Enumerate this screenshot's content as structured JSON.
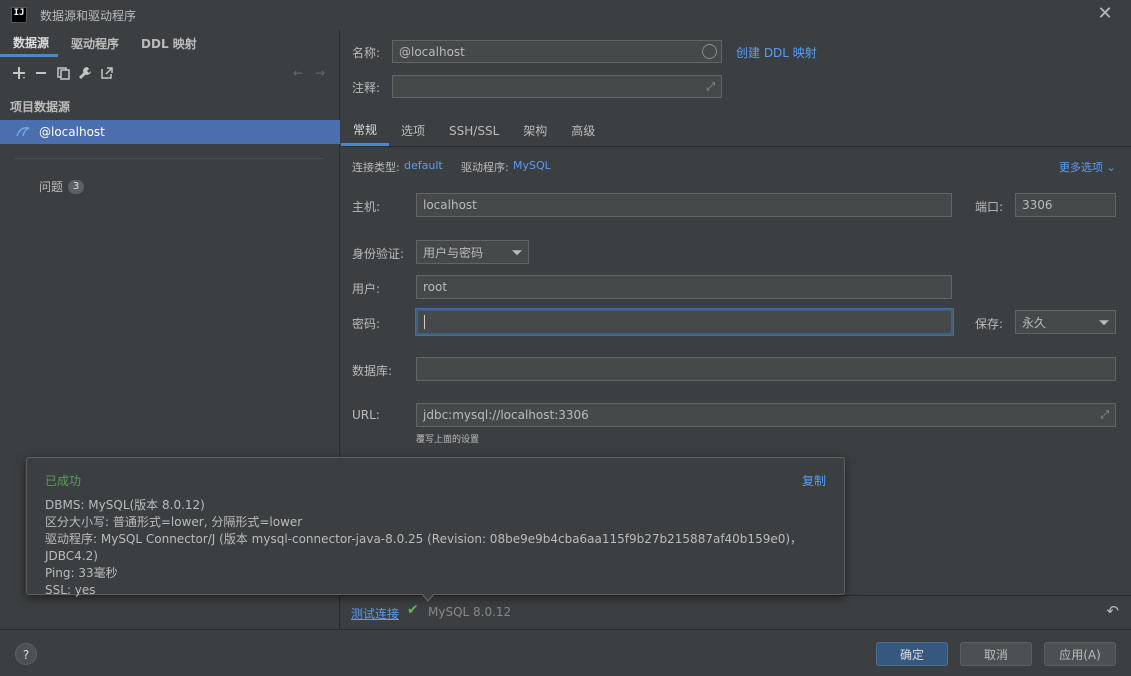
{
  "window": {
    "title": "数据源和驱动程序",
    "app_icon": "IJ"
  },
  "left": {
    "tabs": [
      {
        "label": "数据源"
      },
      {
        "label": "驱动程序"
      },
      {
        "label": "DDL 映射"
      }
    ],
    "section_title": "项目数据源",
    "datasource": "@localhost",
    "problems_label": "问题",
    "problems_count": "3"
  },
  "top": {
    "name_label": "名称:",
    "name_value": "@localhost",
    "create_ddl_link": "创建 DDL 映射",
    "comment_label": "注释:"
  },
  "tabs": [
    {
      "label": "常规"
    },
    {
      "label": "选项"
    },
    {
      "label": "SSH/SSL"
    },
    {
      "label": "架构"
    },
    {
      "label": "高级"
    }
  ],
  "general": {
    "conn_type_label": "连接类型:",
    "conn_type_value": "default",
    "driver_label": "驱动程序:",
    "driver_value": "MySQL",
    "more_options": "更多选项",
    "host_label": "主机:",
    "host_value": "localhost",
    "port_label": "端口:",
    "port_value": "3306",
    "auth_label": "身份验证:",
    "auth_value": "用户与密码",
    "user_label": "用户:",
    "user_value": "root",
    "password_label": "密码:",
    "save_label": "保存:",
    "save_value": "永久",
    "db_label": "数据库:",
    "url_label": "URL:",
    "url_value": "jdbc:mysql://localhost:3306",
    "url_hint": "覆写上面的设置"
  },
  "popup": {
    "status": "已成功",
    "copy": "复制",
    "lines": [
      "DBMS: MySQL(版本 8.0.12)",
      "区分大小写: 普通形式=lower, 分隔形式=lower",
      "驱动程序: MySQL Connector/J (版本 mysql-connector-java-8.0.25 (Revision: 08be9e9b4cba6aa115f9b27b215887af40b159e0)，JDBC4.2)",
      "Ping: 33毫秒",
      "SSL: yes"
    ]
  },
  "status": {
    "test_link": "测试连接",
    "version": "MySQL 8.0.12"
  },
  "footer": {
    "help": "?",
    "ok": "确定",
    "cancel": "取消",
    "apply": "应用(A)"
  }
}
